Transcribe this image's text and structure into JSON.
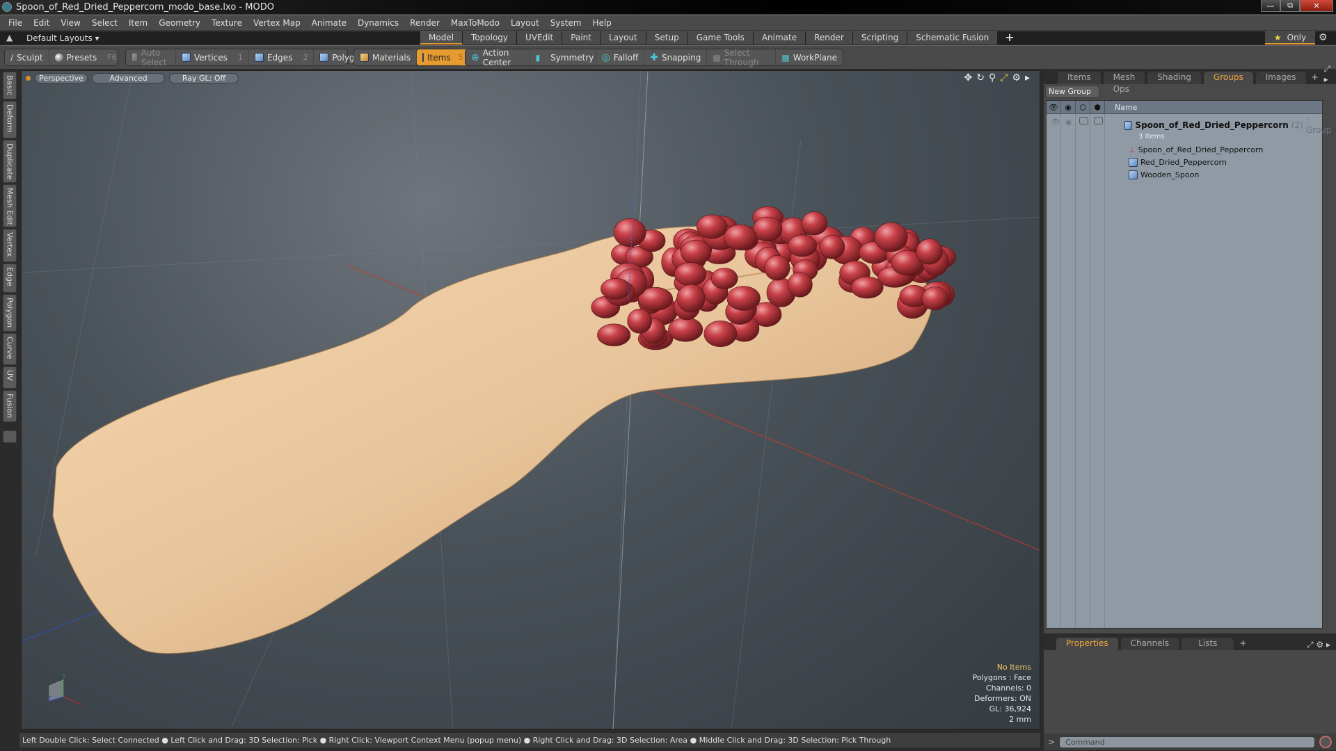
{
  "window": {
    "title": "Spoon_of_Red_Dried_Peppercorn_modo_base.lxo - MODO",
    "controls": [
      "minimize",
      "restore",
      "close"
    ]
  },
  "menubar": [
    "File",
    "Edit",
    "View",
    "Select",
    "Item",
    "Geometry",
    "Texture",
    "Vertex Map",
    "Animate",
    "Dynamics",
    "Render",
    "MaxToModo",
    "Layout",
    "System",
    "Help"
  ],
  "layoutbar": {
    "layouts_label": "Default Layouts",
    "tabs": [
      "Model",
      "Topology",
      "UVEdit",
      "Paint",
      "Layout",
      "Setup",
      "Game Tools",
      "Animate",
      "Render",
      "Scripting",
      "Schematic Fusion"
    ],
    "active_tab": "Model",
    "add_label": "+",
    "only_label": "Only"
  },
  "toolbar": {
    "sculpt": "Sculpt",
    "presets": "Presets",
    "presets_key": "F6",
    "auto_select": "Auto Select",
    "vertices": "Vertices",
    "vertices_key": "1",
    "edges": "Edges",
    "edges_key": "2",
    "polygons": "Polygons",
    "materials": "Materials",
    "items": "Items",
    "items_key": "5",
    "action_center": "Action Center",
    "symmetry": "Symmetry",
    "falloff": "Falloff",
    "snapping": "Snapping",
    "select_through": "Select Through",
    "workplane": "WorkPlane"
  },
  "left_tabs": [
    "Basic",
    "Deform",
    "Duplicate",
    "Mesh Edit",
    "Vertex",
    "Edge",
    "Polygon",
    "Curve",
    "UV",
    "Fusion"
  ],
  "viewport": {
    "view_label": "Perspective",
    "shading_label": "Advanced",
    "raygl_label": "Ray GL: Off",
    "info": {
      "selection": "No Items",
      "polygons": "Polygons : Face",
      "channels": "Channels: 0",
      "deformers": "Deformers: ON",
      "gl": "GL: 36,924",
      "scale": "2 mm"
    },
    "axis_labels": {
      "x": "X",
      "y": "Y",
      "z": "Z"
    }
  },
  "right_panel": {
    "tabs": [
      "Items",
      "Mesh Ops",
      "Shading",
      "Groups",
      "Images"
    ],
    "active_tab": "Groups",
    "add_label": "+",
    "new_group_label": "New Group",
    "column_name": "Name",
    "group": {
      "name": "Spoon_of_Red_Dried_Peppercorn",
      "count": "(2)",
      "type": ": Group",
      "sub": "3 Items",
      "children": [
        {
          "name": "Spoon_of_Red_Dried_Peppercorn",
          "icon": "locator-icon"
        },
        {
          "name": "Red_Dried_Peppercorn",
          "icon": "mesh-icon"
        },
        {
          "name": "Wooden_Spoon",
          "icon": "mesh-icon"
        }
      ]
    }
  },
  "bottom_panel": {
    "tabs": [
      "Properties",
      "Channels",
      "Lists"
    ],
    "active_tab": "Properties",
    "add_label": "+"
  },
  "command": {
    "prompt": ">",
    "placeholder": "Command"
  },
  "statusbar": {
    "text": "Left Double Click: Select Connected ● Left Click and Drag: 3D Selection: Pick ● Right Click: Viewport Context Menu (popup menu) ● Right Click and Drag: 3D Selection: Area ● Middle Click and Drag: 3D Selection: Pick Through"
  },
  "colors": {
    "accent": "#e2962e",
    "active_tab_text": "#f0a53a",
    "info_highlight": "#f2c56a",
    "viewport_bg": "#4a5259",
    "spoon_wood": "#e8c49a",
    "peppercorn": "#b8343a"
  }
}
